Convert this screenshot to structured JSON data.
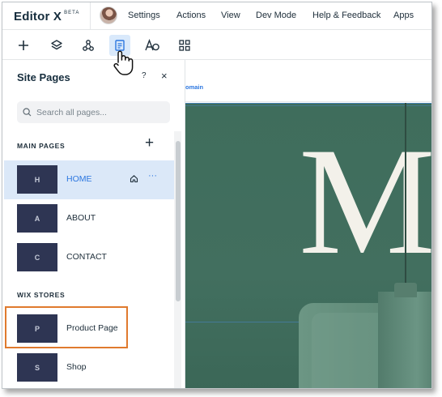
{
  "app": {
    "logo": "Editor X",
    "logo_badge": "BETA"
  },
  "menu": {
    "items": [
      "Settings",
      "Actions",
      "View",
      "Dev Mode",
      "Help & Feedback",
      "Apps"
    ]
  },
  "toolbar": {
    "tools": [
      {
        "icon": "plus-icon",
        "name": "add"
      },
      {
        "icon": "layers-icon",
        "name": "layers"
      },
      {
        "icon": "connections-icon",
        "name": "components"
      },
      {
        "icon": "pages-icon",
        "name": "pages",
        "active": true
      },
      {
        "icon": "text-theme-icon",
        "name": "text-theme"
      },
      {
        "icon": "apps-grid-icon",
        "name": "apps"
      }
    ]
  },
  "panel": {
    "title": "Site Pages",
    "help": "?",
    "close": "×",
    "search_placeholder": "Search all pages...",
    "main_section": "MAIN PAGES",
    "stores_section": "WIX STORES",
    "main_pages": [
      {
        "initial": "H",
        "name": "HOME",
        "selected": true,
        "is_home": true
      },
      {
        "initial": "A",
        "name": "ABOUT"
      },
      {
        "initial": "C",
        "name": "CONTACT"
      }
    ],
    "store_pages": [
      {
        "initial": "P",
        "name": "Product Page",
        "highlighted": true
      },
      {
        "initial": "S",
        "name": "Shop"
      }
    ]
  },
  "canvas": {
    "domain_text": "omain",
    "hero_letter": "M"
  },
  "colors": {
    "accent": "#2c77e0",
    "selected_row": "#dbe8f8",
    "thumb": "#2e3553",
    "highlight": "#e07a2e",
    "hero": "#426f5f"
  }
}
